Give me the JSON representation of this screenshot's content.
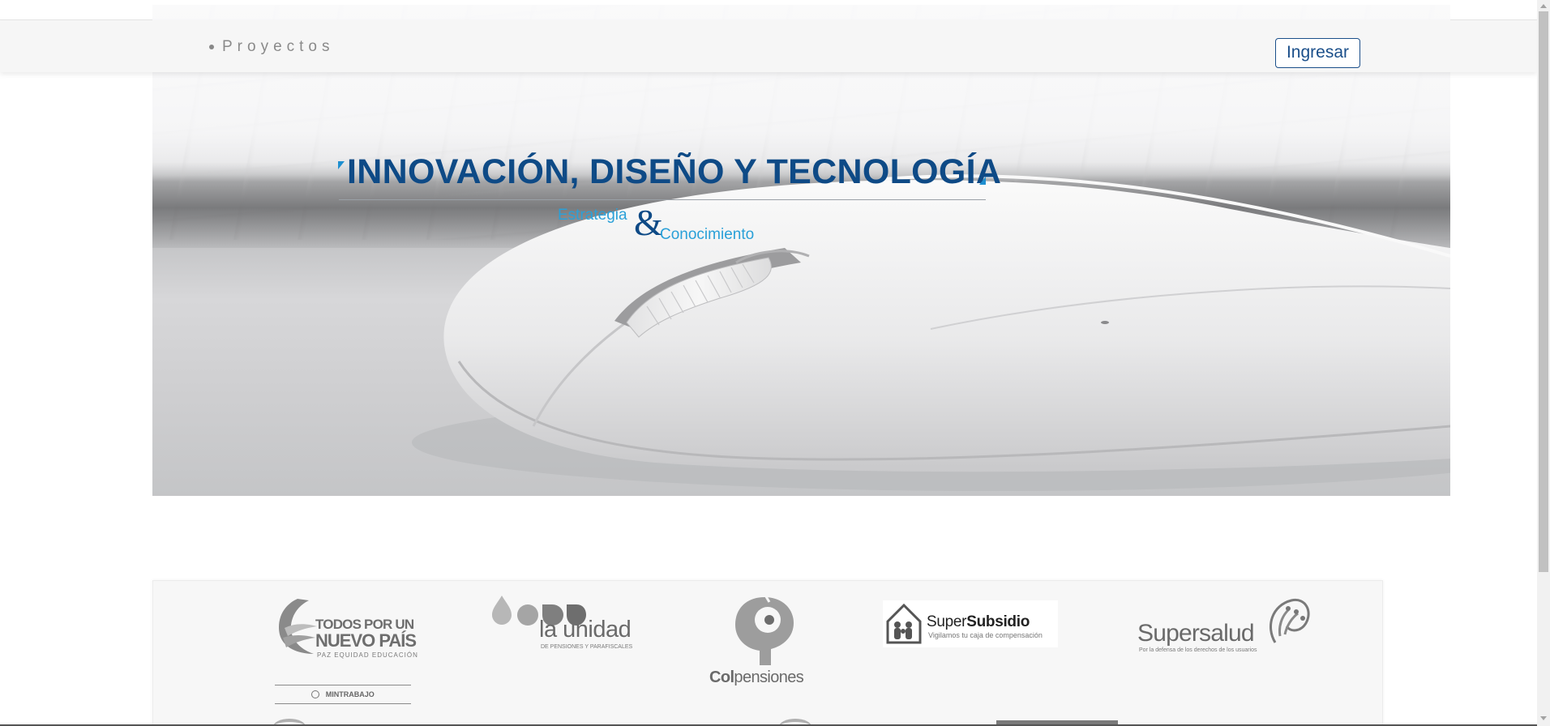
{
  "navbar": {
    "items": [
      {
        "label": "Proyectos"
      }
    ],
    "login_label": "Ingresar"
  },
  "hero": {
    "headline": "INNOVACIÓN, DISEÑO Y TECNOLOGÍA",
    "sub_left": "Estrategia",
    "sub_amp": "&",
    "sub_right": "Conocimiento"
  },
  "logos": [
    {
      "name": "Todos por un nuevo país",
      "line1": "TODOS POR UN",
      "line2": "NUEVO PAÍS",
      "tagline": "PAZ  EQUIDAD  EDUCACIÓN",
      "footer": "MINTRABAJO"
    },
    {
      "name": "La Unidad",
      "main": "la unidad",
      "tagline": "DE PENSIONES Y PARAFISCALES"
    },
    {
      "name": "Colpensiones",
      "bold": "Col",
      "rest": "pensiones"
    },
    {
      "name": "SuperSubsidio",
      "light": "Super",
      "bold": "Subsidio",
      "tagline": "Vigilamos tu caja de compensación"
    },
    {
      "name": "Supersalud",
      "main": "Supersalud",
      "tagline": "Por la defensa de los derechos de los usuarios"
    }
  ],
  "colors": {
    "brand_navy": "#0e4a86",
    "brand_cyan": "#2aa0d8",
    "button_border": "#1b4f8a"
  }
}
